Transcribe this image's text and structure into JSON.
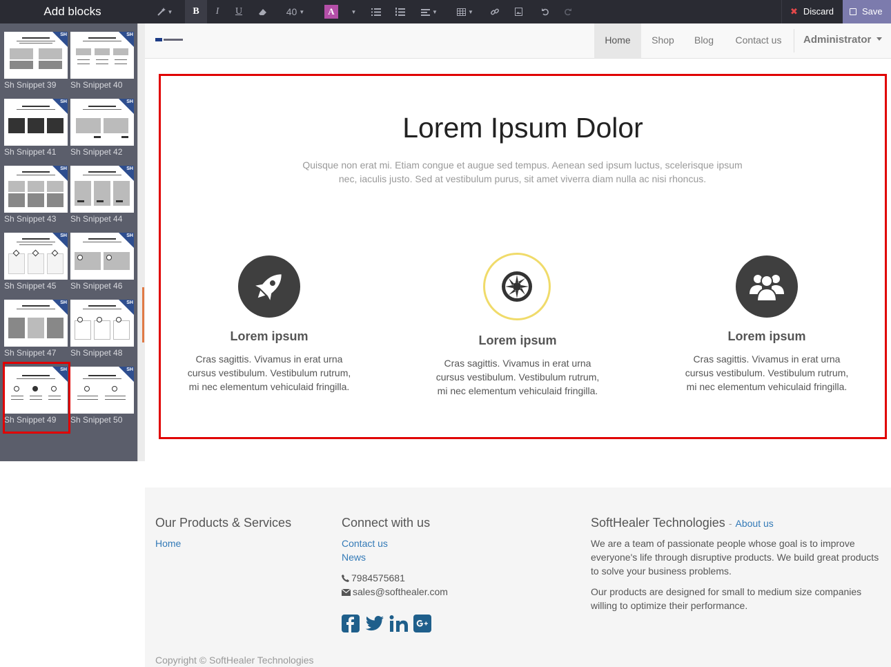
{
  "sidebar": {
    "title": "Add blocks",
    "snippets": [
      {
        "label": "Sh Snippet 39"
      },
      {
        "label": "Sh Snippet 40"
      },
      {
        "label": "Sh Snippet 41"
      },
      {
        "label": "Sh Snippet 42"
      },
      {
        "label": "Sh Snippet 43"
      },
      {
        "label": "Sh Snippet 44"
      },
      {
        "label": "Sh Snippet 45"
      },
      {
        "label": "Sh Snippet 46"
      },
      {
        "label": "Sh Snippet 47"
      },
      {
        "label": "Sh Snippet 48"
      },
      {
        "label": "Sh Snippet 49"
      },
      {
        "label": "Sh Snippet 50"
      }
    ],
    "selected": "Sh Snippet 49",
    "badge_text": "SH"
  },
  "toolbar": {
    "bold_label": "B",
    "italic_label": "I",
    "underline_label": "U",
    "font_size": "40",
    "color_label": "A",
    "discard_label": "Discard",
    "save_label": "Save"
  },
  "navbar": {
    "items": [
      "Home",
      "Shop",
      "Blog",
      "Contact us"
    ],
    "active": "Home",
    "user": "Administrator"
  },
  "section": {
    "title": "Lorem Ipsum Dolor",
    "text": "Quisque non erat mi. Etiam congue et augue sed tempus. Aenean sed ipsum luctus, scelerisque ipsum nec, iaculis justo. Sed at vestibulum purus, sit amet viverra diam nulla ac nisi rhoncus.",
    "features": [
      {
        "icon": "rocket-icon",
        "title": "Lorem ipsum",
        "text": "Cras sagittis. Vivamus in erat urna cursus vestibulum. Vestibulum rutrum, mi nec elementum vehiculaid fringilla."
      },
      {
        "icon": "first-order-icon",
        "title": "Lorem ipsum",
        "text": "Cras sagittis. Vivamus in erat urna cursus vestibulum. Vestibulum rutrum, mi nec elementum vehiculaid fringilla."
      },
      {
        "icon": "users-icon",
        "title": "Lorem ipsum",
        "text": "Cras sagittis. Vivamus in erat urna cursus vestibulum. Vestibulum rutrum, mi nec elementum vehiculaid fringilla."
      }
    ]
  },
  "footer": {
    "products_title": "Our Products & Services",
    "products_links": [
      "Home"
    ],
    "connect_title": "Connect with us",
    "connect_links": [
      "Contact us",
      "News"
    ],
    "phone": "7984575681",
    "email": "sales@softhealer.com",
    "company_title": "SoftHealer Technologies",
    "company_sep": "-",
    "about_link": "About us",
    "about_p1": "We are a team of passionate people whose goal is to improve everyone's life through disruptive products. We build great products to solve your business problems.",
    "about_p2": "Our products are designed for small to medium size companies willing to optimize their performance.",
    "copyright": "Copyright © SoftHealer Technologies",
    "social": [
      "facebook-icon",
      "twitter-icon",
      "linkedin-icon",
      "google-plus-icon"
    ]
  },
  "colors": {
    "toolbar_bg": "#2a2b33",
    "sidebar_panel": "#5b5e6b",
    "save_bg": "#7c7bad",
    "selection_red": "#e00000",
    "link_blue": "#337ab7",
    "social_blue": "#1f5f8b",
    "icon_yellow_ring": "#f0db6a"
  }
}
